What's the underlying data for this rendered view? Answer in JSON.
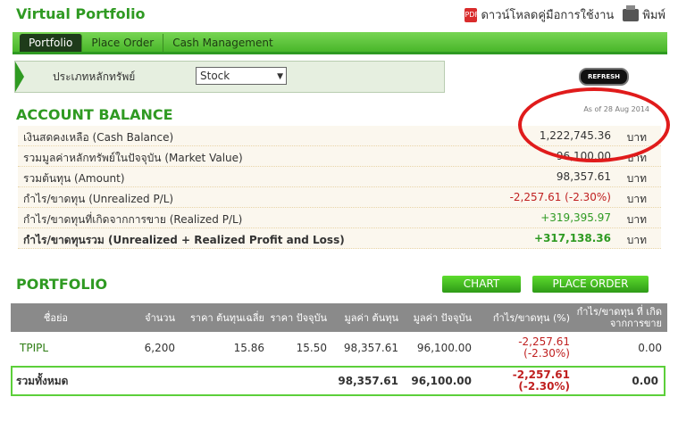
{
  "app": {
    "title": "Virtual Portfolio",
    "download_label": "ดาวน์โหลดคู่มือการใช้งาน",
    "print_label": "พิมพ์"
  },
  "tabs": [
    {
      "label": "Portfolio",
      "active": true
    },
    {
      "label": "Place Order",
      "active": false
    },
    {
      "label": "Cash Management",
      "active": false
    }
  ],
  "filter": {
    "label": "ประเภทหลักทรัพย์",
    "selected": "Stock"
  },
  "refresh_label": "REFRESH",
  "account": {
    "heading": "ACCOUNT BALANCE",
    "as_of": "As of 28 Aug 2014",
    "rows": [
      {
        "label": "เงินสดคงเหลือ (Cash Balance)",
        "value": "1,222,745.36",
        "unit": "บาท"
      },
      {
        "label": "รวมมูลค่าหลักทรัพย์ในปัจจุบัน (Market Value)",
        "value": "96,100.00",
        "unit": "บาท"
      },
      {
        "label": "รวมต้นทุน (Amount)",
        "value": "98,357.61",
        "unit": "บาท"
      },
      {
        "label": "กำไร/ขาดทุน (Unrealized P/L)",
        "value": "-2,257.61 (-2.30%)",
        "unit": "บาท"
      },
      {
        "label": "กำไร/ขาดทุนที่เกิดจากการขาย (Realized P/L)",
        "value": "+319,395.97",
        "unit": "บาท"
      },
      {
        "label": "กำไร/ขาดทุนรวม (Unrealized + Realized Profit and Loss)",
        "value": "+317,138.36",
        "unit": "บาท"
      }
    ]
  },
  "portfolio": {
    "heading": "PORTFOLIO",
    "chart_label": "CHART",
    "place_order_label": "PLACE ORDER",
    "columns": [
      "ชื่อย่อ",
      "จำนวน",
      "ราคา ต้นทุนเฉลี่ย",
      "ราคา ปัจจุบัน",
      "มูลค่า ต้นทุน",
      "มูลค่า ปัจจุบัน",
      "กำไร/ขาดทุน (%)",
      "กำไร/ขาดทุน ที่ เกิดจากการขาย"
    ],
    "rows": [
      {
        "symbol": "TPIPL",
        "qty": "6,200",
        "avg_cost": "15.86",
        "price": "15.50",
        "cost_value": "98,357.61",
        "market_value": "96,100.00",
        "pl": "-2,257.61",
        "pl_pct": "(-2.30%)",
        "realized": "0.00"
      }
    ],
    "total": {
      "label": "รวมทั้งหมด",
      "cost_value": "98,357.61",
      "market_value": "96,100.00",
      "pl": "-2,257.61",
      "pl_pct": "(-2.30%)",
      "realized": "0.00"
    }
  }
}
